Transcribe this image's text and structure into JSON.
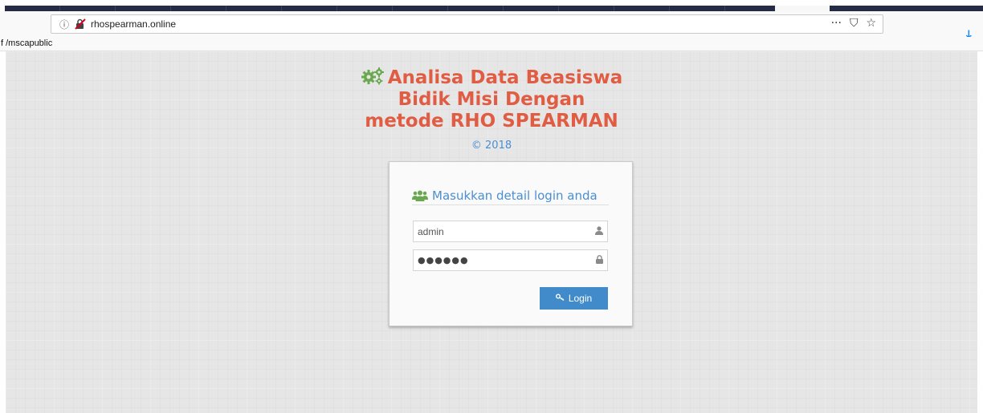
{
  "browser": {
    "url": "rhospearman.online",
    "info_icon": "info-circle-icon",
    "insecure_icon": "insecure-lock-icon",
    "page_actions_label": "···",
    "pocket_label": "⛉",
    "star_label": "☆",
    "download_label": "⤓",
    "bookmark": "f /mscapublic"
  },
  "page": {
    "title_lines": [
      "Analisa Data Beasiswa",
      "Bidik Misi Dengan",
      "metode RHO SPEARMAN"
    ],
    "copyright": "© 2018",
    "title_color": "#e05d44",
    "accent_color": "#4a8fd0"
  },
  "login": {
    "heading": "Masukkan detail login anda",
    "username_value": "admin",
    "password_mask": "●●●●●●",
    "username_icon": "user-icon",
    "password_icon": "lock-icon",
    "button_label": "Login",
    "button_icon": "key-icon",
    "button_color": "#428bca"
  }
}
